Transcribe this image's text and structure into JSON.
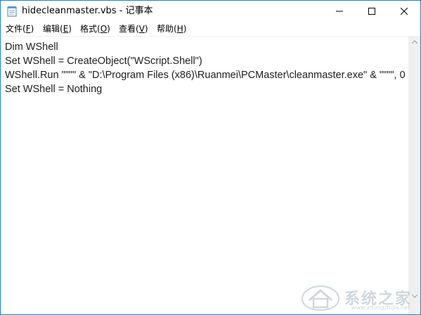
{
  "window": {
    "title": "hidecleanmaster.vbs - 记事本"
  },
  "menu": {
    "file": {
      "label": "文件(",
      "key": "F",
      "close": ")"
    },
    "edit": {
      "label": "编辑(",
      "key": "E",
      "close": ")"
    },
    "format": {
      "label": "格式(",
      "key": "O",
      "close": ")"
    },
    "view": {
      "label": "查看(",
      "key": "V",
      "close": ")"
    },
    "help": {
      "label": "帮助(",
      "key": "H",
      "close": ")"
    }
  },
  "editor": {
    "lines": [
      "Dim WShell",
      "Set WShell = CreateObject(\"WScript.Shell\")",
      "WShell.Run \"\"\"\" & \"D:\\Program Files (x86)\\Ruanmei\\PCMaster\\cleanmaster.exe\" & \"\"\"\", 0",
      "Set WShell = Nothing"
    ]
  },
  "watermark": {
    "text": "系统之家",
    "url": "www.xitongzhijia.net"
  },
  "icons": {
    "app": "notepad-icon",
    "minimize": "minimize-icon",
    "maximize": "maximize-icon",
    "close": "close-icon",
    "scroll_up": "chevron-up-icon",
    "scroll_down": "chevron-down-icon"
  }
}
